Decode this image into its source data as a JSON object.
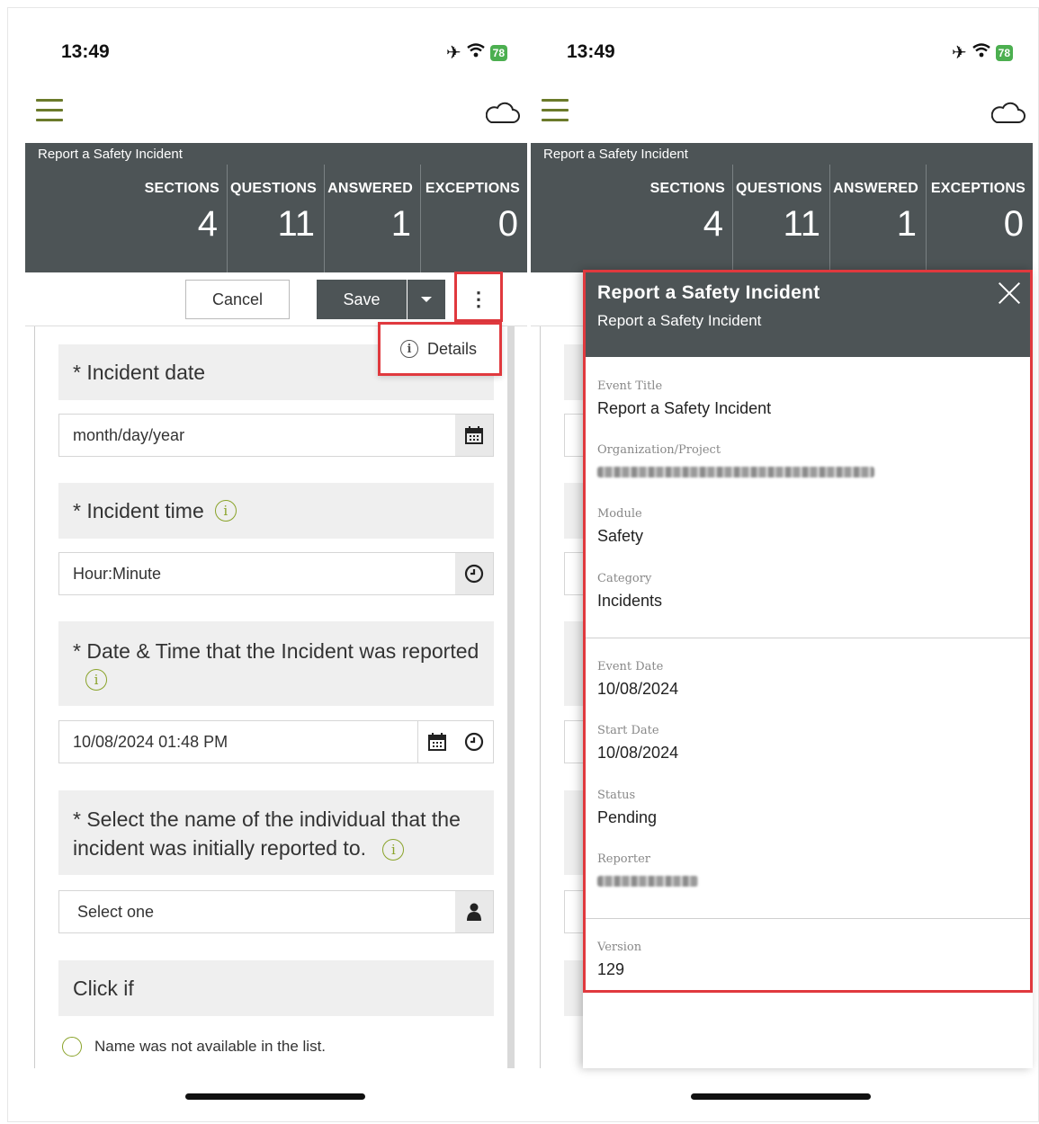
{
  "status_bar": {
    "time": "13:49",
    "battery": "78"
  },
  "header": {
    "title": "Report a Safety Incident",
    "stats": [
      {
        "label": "SECTIONS",
        "value": "4"
      },
      {
        "label": "QUESTIONS",
        "value": "11"
      },
      {
        "label": "ANSWERED",
        "value": "1"
      },
      {
        "label": "EXCEPTIONS",
        "value": "0"
      }
    ]
  },
  "toolbar": {
    "cancel_label": "Cancel",
    "save_label": "Save",
    "more_label": "⋮"
  },
  "menu": {
    "details_label": "Details"
  },
  "form": {
    "q1": "* Incident date",
    "q1_placeholder": "month/day/year",
    "q2": "* Incident time",
    "q2_placeholder": "Hour:Minute",
    "q3": "* Date & Time that the Incident was reported",
    "q3_value": "10/08/2024 01:48 PM",
    "q4": "* Select the name of the individual that the incident was initially reported to.",
    "q4_placeholder": "Select one",
    "q5": "Click if",
    "q5_option": "Name was not available in the list."
  },
  "details_panel": {
    "title": "Report a Safety Incident",
    "subtitle": "Report a Safety Incident",
    "event_title_label": "Event Title",
    "event_title": "Report a Safety Incident",
    "org_label": "Organization/Project",
    "module_label": "Module",
    "module": "Safety",
    "category_label": "Category",
    "category": "Incidents",
    "event_date_label": "Event Date",
    "event_date": "10/08/2024",
    "start_date_label": "Start Date",
    "start_date": "10/08/2024",
    "status_label": "Status",
    "status": "Pending",
    "reporter_label": "Reporter",
    "version_label": "Version",
    "version": "129"
  },
  "colors": {
    "header_bg": "#4d5456",
    "accent_green": "#8aa32a",
    "highlight_red": "#e0393e"
  }
}
